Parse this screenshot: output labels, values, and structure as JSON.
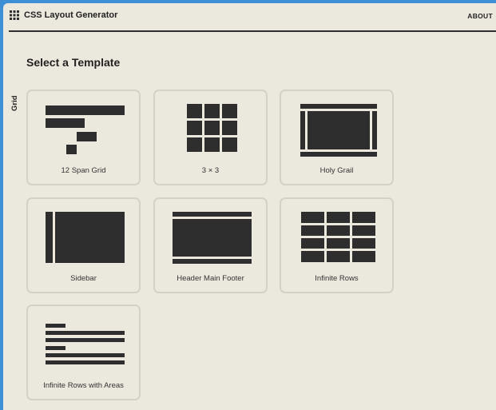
{
  "app": {
    "title": "CSS Layout Generator",
    "about": "ABOUT"
  },
  "side_tab": "Grid",
  "heading": "Select a Template",
  "templates": [
    {
      "label": "12 Span Grid"
    },
    {
      "label": "3 × 3"
    },
    {
      "label": "Holy Grail"
    },
    {
      "label": "Sidebar"
    },
    {
      "label": "Header Main Footer"
    },
    {
      "label": "Infinite Rows"
    },
    {
      "label": "Infinite Rows with Areas"
    }
  ],
  "colors": {
    "accent": "#2e2e2e",
    "background": "#ebe8de",
    "card_border": "#d4d1c5",
    "frame": "#3f8fd6"
  },
  "icons": [
    "grid-dots-icon"
  ]
}
